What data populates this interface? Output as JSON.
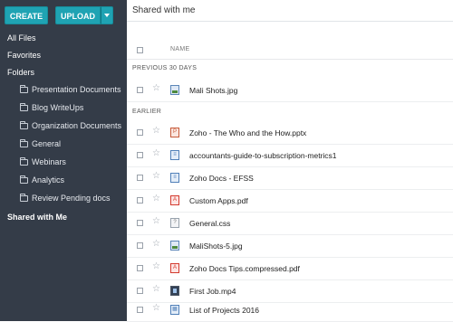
{
  "buttons": {
    "create": "CREATE",
    "upload": "UPLOAD"
  },
  "nav": {
    "all_files": "All Files",
    "favorites": "Favorites",
    "folders": "Folders",
    "shared_with_me": "Shared with Me"
  },
  "folders": [
    "Presentation Documents",
    "Blog WriteUps",
    "Organization Documents",
    "General",
    "Webinars",
    "Analytics",
    "Review Pending docs"
  ],
  "main": {
    "title": "Shared with me",
    "column_name": "NAME",
    "section_previous": "PREVIOUS 30 DAYS",
    "section_earlier": "EARLIER",
    "files_previous": [
      {
        "name": "Mali Shots.jpg",
        "type": "image"
      }
    ],
    "files_earlier": [
      {
        "name": "Zoho - The Who and the How.pptx",
        "type": "pptx"
      },
      {
        "name": "accountants-guide-to-subscription-metrics1",
        "type": "document"
      },
      {
        "name": "Zoho Docs - EFSS",
        "type": "document"
      },
      {
        "name": "Custom Apps.pdf",
        "type": "pdf"
      },
      {
        "name": "General.css",
        "type": "css"
      },
      {
        "name": "MaliShots-5.jpg",
        "type": "image"
      },
      {
        "name": "Zoho Docs Tips.compressed.pdf",
        "type": "pdf"
      },
      {
        "name": "First Job.mp4",
        "type": "video"
      },
      {
        "name": "List of Projects 2016",
        "type": "spreadsheet"
      }
    ]
  },
  "colors": {
    "sidebar_bg": "#343c48",
    "accent": "#1fa3b3"
  }
}
